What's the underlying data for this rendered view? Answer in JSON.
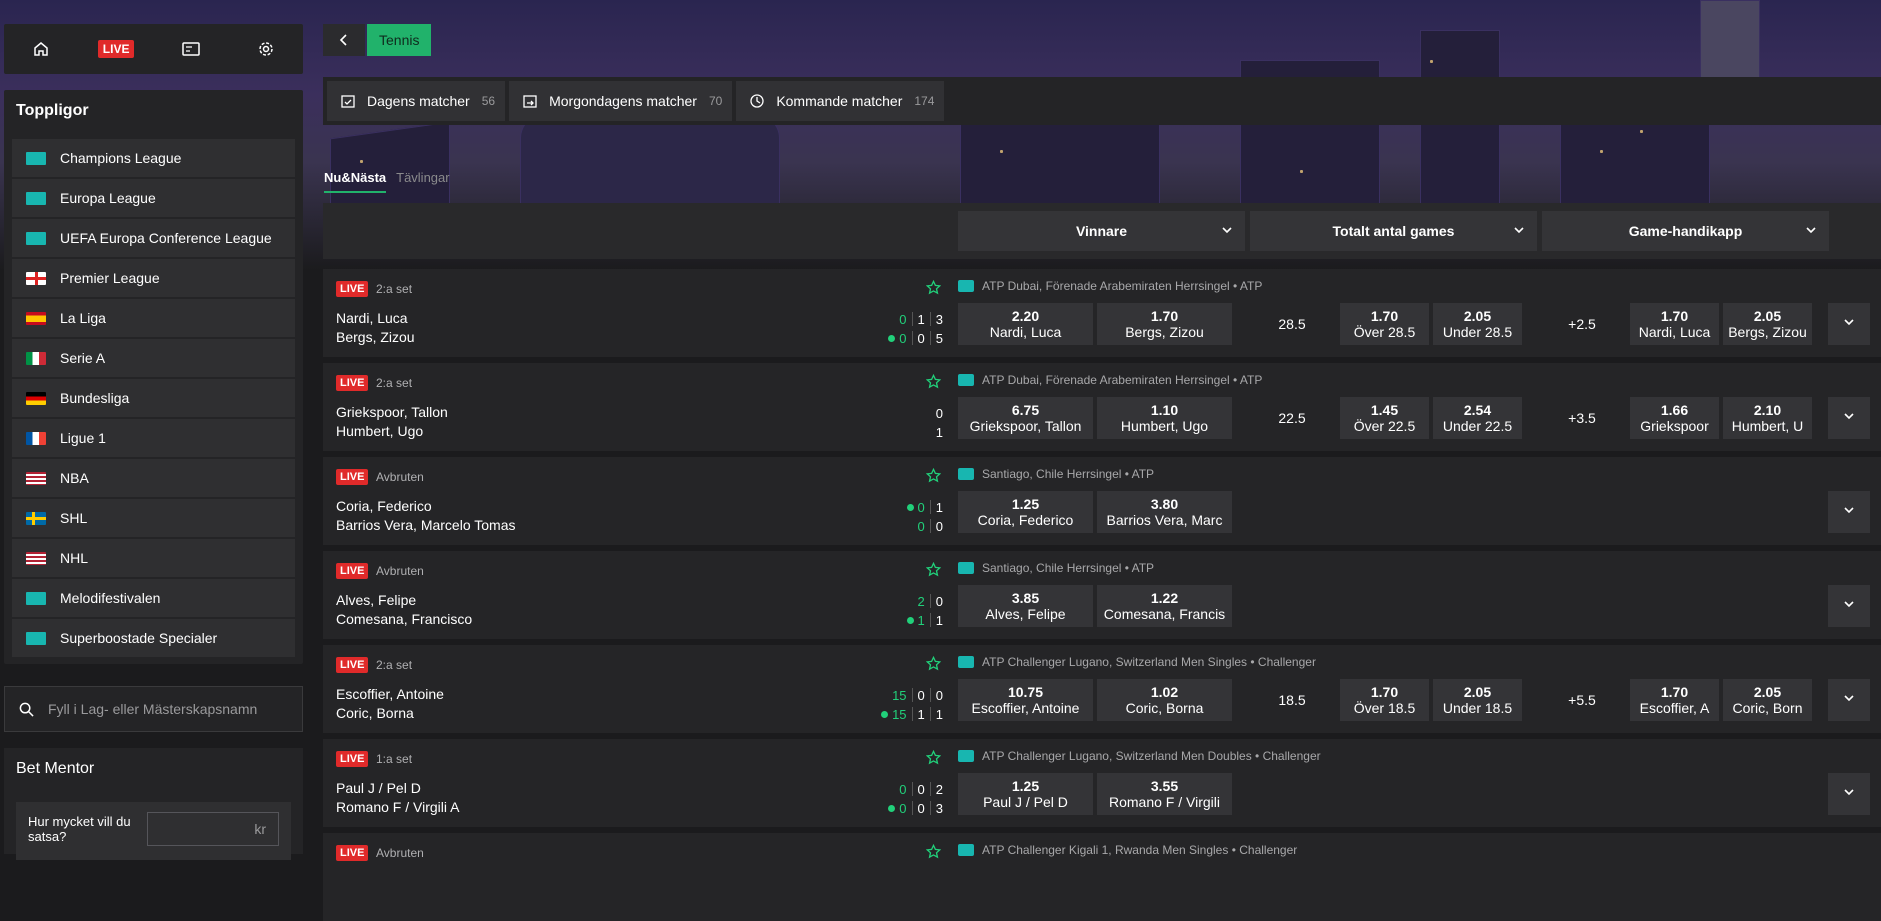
{
  "nav": {
    "live_label": "LIVE"
  },
  "toppligor": {
    "title": "Toppligor",
    "items": [
      {
        "label": "Champions League",
        "flag": "globe"
      },
      {
        "label": "Europa League",
        "flag": "globe"
      },
      {
        "label": "UEFA Europa Conference League",
        "flag": "globe"
      },
      {
        "label": "Premier League",
        "flag": "england"
      },
      {
        "label": "La Liga",
        "flag": "spain"
      },
      {
        "label": "Serie A",
        "flag": "italy"
      },
      {
        "label": "Bundesliga",
        "flag": "germany"
      },
      {
        "label": "Ligue 1",
        "flag": "france"
      },
      {
        "label": "NBA",
        "flag": "usa"
      },
      {
        "label": "SHL",
        "flag": "sweden"
      },
      {
        "label": "NHL",
        "flag": "usa"
      },
      {
        "label": "Melodifestivalen",
        "flag": "globe"
      },
      {
        "label": "Superboostade Specialer",
        "flag": "globe"
      }
    ]
  },
  "search": {
    "placeholder": "Fyll i Lag- eller Mästerskapsnamn"
  },
  "bet_mentor": {
    "title": "Bet Mentor",
    "question": "Hur mycket vill du satsa?",
    "currency": "kr"
  },
  "breadcrumb": {
    "sport": "Tennis"
  },
  "day_tabs": [
    {
      "label": "Dagens matcher",
      "count": "56"
    },
    {
      "label": "Morgondagens matcher",
      "count": "70"
    },
    {
      "label": "Kommande matcher",
      "count": "174"
    }
  ],
  "sub_tabs": {
    "active": "Nu&Nästa",
    "inactive": "Tävlingar"
  },
  "markets": {
    "winner": "Vinnare",
    "total": "Totalt antal games",
    "handicap": "Game-handikapp"
  },
  "matches": [
    {
      "live": "LIVE",
      "status": "2:a set",
      "p1": "Nardi, Luca",
      "p2": "Bergs, Zizou",
      "serve": 2,
      "s1": [
        "0",
        "1",
        "3"
      ],
      "s2": [
        "0",
        "0",
        "5"
      ],
      "comp": "ATP Dubai, Förenade Arabemiraten Herrsingel • ATP",
      "w1": {
        "odds": "2.20",
        "name": "Nardi, Luca"
      },
      "w2": {
        "odds": "1.70",
        "name": "Bergs, Zizou"
      },
      "total_line": "28.5",
      "t1": {
        "odds": "1.70",
        "name": "Över 28.5"
      },
      "t2": {
        "odds": "2.05",
        "name": "Under 28.5"
      },
      "hcp_line": "+2.5",
      "h1": {
        "odds": "1.70",
        "name": "Nardi, Luca"
      },
      "h2": {
        "odds": "2.05",
        "name": "Bergs, Zizou"
      }
    },
    {
      "live": "LIVE",
      "status": "2:a set",
      "p1": "Griekspoor, Tallon",
      "p2": "Humbert, Ugo",
      "serve": 0,
      "s1": [
        "0"
      ],
      "s2": [
        "1"
      ],
      "comp": "ATP Dubai, Förenade Arabemiraten Herrsingel • ATP",
      "w1": {
        "odds": "6.75",
        "name": "Griekspoor, Tallon"
      },
      "w2": {
        "odds": "1.10",
        "name": "Humbert, Ugo"
      },
      "total_line": "22.5",
      "t1": {
        "odds": "1.45",
        "name": "Över 22.5"
      },
      "t2": {
        "odds": "2.54",
        "name": "Under 22.5"
      },
      "hcp_line": "+3.5",
      "h1": {
        "odds": "1.66",
        "name": "Griekspoor"
      },
      "h2": {
        "odds": "2.10",
        "name": "Humbert, U"
      }
    },
    {
      "live": "LIVE",
      "status": "Avbruten",
      "p1": "Coria, Federico",
      "p2": "Barrios Vera, Marcelo Tomas",
      "serve": 1,
      "s1": [
        "0",
        "1"
      ],
      "s2": [
        "0",
        "0"
      ],
      "comp": "Santiago, Chile Herrsingel • ATP",
      "w1": {
        "odds": "1.25",
        "name": "Coria, Federico"
      },
      "w2": {
        "odds": "3.80",
        "name": "Barrios Vera, Marc"
      }
    },
    {
      "live": "LIVE",
      "status": "Avbruten",
      "p1": "Alves, Felipe",
      "p2": "Comesana, Francisco",
      "serve": 2,
      "s1": [
        "2",
        "0"
      ],
      "s2": [
        "1",
        "1"
      ],
      "comp": "Santiago, Chile Herrsingel • ATP",
      "w1": {
        "odds": "3.85",
        "name": "Alves, Felipe"
      },
      "w2": {
        "odds": "1.22",
        "name": "Comesana, Francis"
      }
    },
    {
      "live": "LIVE",
      "status": "2:a set",
      "p1": "Escoffier, Antoine",
      "p2": "Coric, Borna",
      "serve": 2,
      "s1": [
        "15",
        "0",
        "0"
      ],
      "s2": [
        "15",
        "1",
        "1"
      ],
      "comp": "ATP Challenger Lugano, Switzerland Men Singles • Challenger",
      "w1": {
        "odds": "10.75",
        "name": "Escoffier, Antoine"
      },
      "w2": {
        "odds": "1.02",
        "name": "Coric, Borna"
      },
      "total_line": "18.5",
      "t1": {
        "odds": "1.70",
        "name": "Över 18.5"
      },
      "t2": {
        "odds": "2.05",
        "name": "Under 18.5"
      },
      "hcp_line": "+5.5",
      "h1": {
        "odds": "1.70",
        "name": "Escoffier, A"
      },
      "h2": {
        "odds": "2.05",
        "name": "Coric, Born"
      }
    },
    {
      "live": "LIVE",
      "status": "1:a set",
      "p1": "Paul J / Pel D",
      "p2": "Romano F / Virgili A",
      "serve": 2,
      "s1": [
        "0",
        "0",
        "2"
      ],
      "s2": [
        "0",
        "0",
        "3"
      ],
      "comp": "ATP Challenger Lugano, Switzerland Men Doubles • Challenger",
      "w1": {
        "odds": "1.25",
        "name": "Paul J / Pel D"
      },
      "w2": {
        "odds": "3.55",
        "name": "Romano F / Virgili"
      }
    },
    {
      "live": "LIVE",
      "status": "Avbruten",
      "p1": "",
      "p2": "",
      "serve": 0,
      "s1": [],
      "s2": [],
      "comp": "ATP Challenger Kigali 1, Rwanda Men Singles • Challenger"
    }
  ]
}
